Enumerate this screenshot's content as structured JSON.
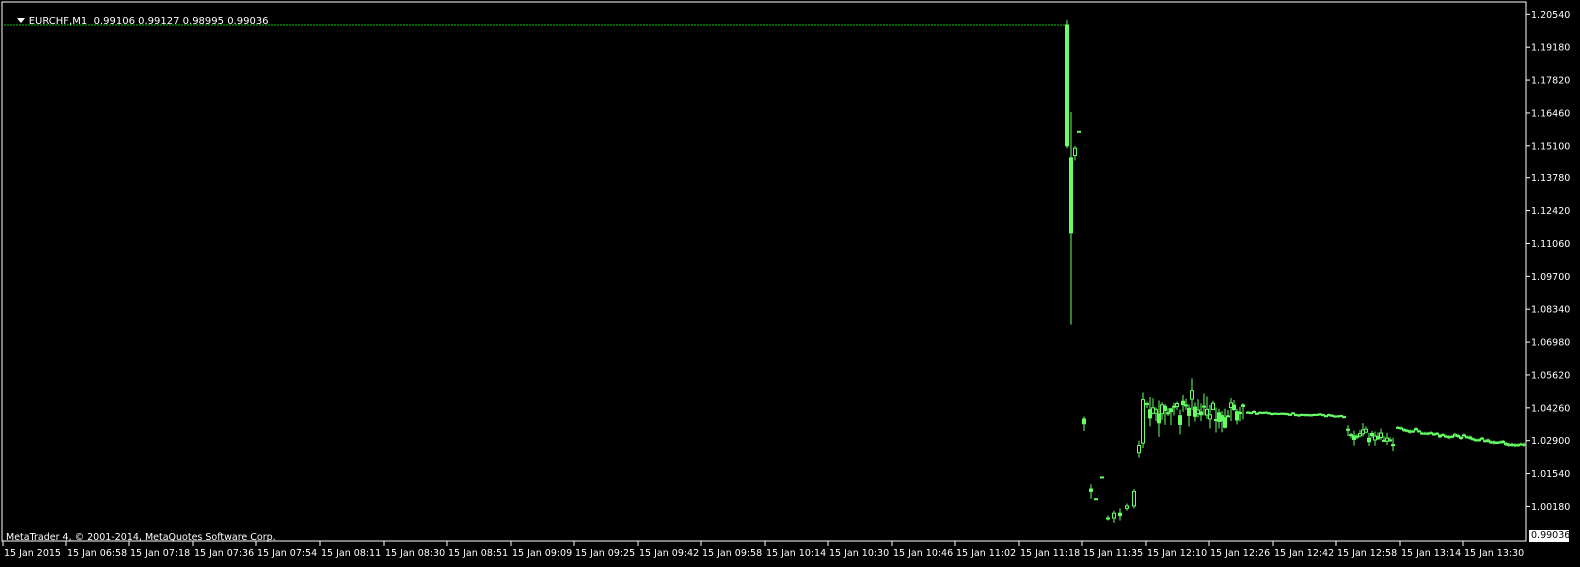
{
  "header": {
    "symbol": "EURCHF,M1",
    "ohlc": "0.99106 0.99127 0.98995 0.99036"
  },
  "copyright": "MetaTrader 4, © 2001-2014, MetaQuotes Software Corp.",
  "current_price_label": "0.99036",
  "colors": {
    "background": "#000000",
    "candle": "#66ff66",
    "grid_line": "#00cc00",
    "axis": "#ffffff"
  },
  "chart_data": {
    "type": "candlestick",
    "y_ticks": [
      "1.20540",
      "1.19180",
      "1.17820",
      "1.16460",
      "1.15100",
      "1.13780",
      "1.12420",
      "1.11060",
      "1.09700",
      "1.08340",
      "1.06980",
      "1.05620",
      "1.04260",
      "1.02900",
      "1.01540",
      "1.00180"
    ],
    "ylim": [
      0.9875,
      1.2105
    ],
    "x_ticks": [
      "15 Jan 2015",
      "15 Jan 06:58",
      "15 Jan 07:18",
      "15 Jan 07:36",
      "15 Jan 07:54",
      "15 Jan 08:11",
      "15 Jan 08:30",
      "15 Jan 08:51",
      "15 Jan 09:09",
      "15 Jan 09:25",
      "15 Jan 09:42",
      "15 Jan 09:58",
      "15 Jan 10:14",
      "15 Jan 10:30",
      "15 Jan 10:46",
      "15 Jan 11:02",
      "15 Jan 11:18",
      "15 Jan 11:35",
      "15 Jan 12:10",
      "15 Jan 12:26",
      "15 Jan 12:42",
      "15 Jan 12:58",
      "15 Jan 13:14",
      "15 Jan 13:30"
    ],
    "flat_level": 1.201,
    "last_price": 0.99036
  }
}
